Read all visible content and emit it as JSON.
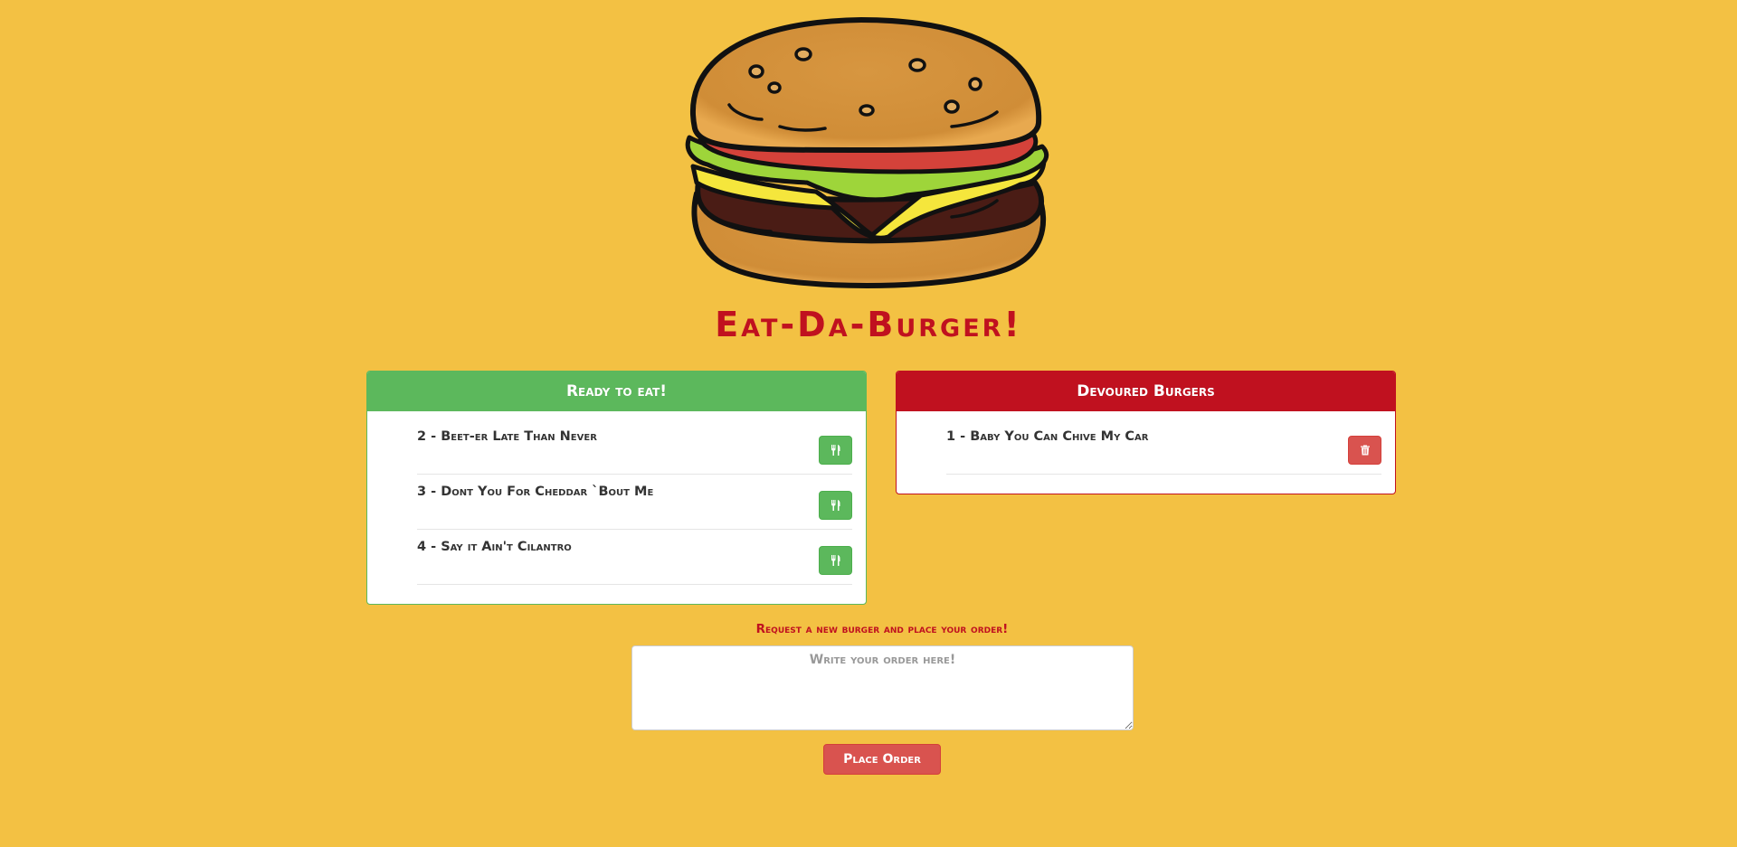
{
  "page": {
    "title": "Eat-Da-Burger!",
    "logo_icon": "hamburger-icon"
  },
  "ready_panel": {
    "heading": "Ready to eat!",
    "items": [
      {
        "label": "2 - Beet-er Late Than Never",
        "button_icon": "cutlery-icon"
      },
      {
        "label": "3 - Dont You For Cheddar `Bout Me",
        "button_icon": "cutlery-icon"
      },
      {
        "label": "4 - Say it Ain't Cilantro",
        "button_icon": "cutlery-icon"
      }
    ]
  },
  "devoured_panel": {
    "heading": "Devoured Burgers",
    "items": [
      {
        "label": "1 - Baby You Can Chive My Car",
        "button_icon": "trash-icon"
      }
    ]
  },
  "order_form": {
    "label": "Request a new burger and place your order!",
    "placeholder": "Write your order here!",
    "value": "",
    "submit_label": "Place Order"
  },
  "colors": {
    "background": "#f3c143",
    "brand_red": "#c0111f",
    "success_green": "#5cb85c",
    "danger_red": "#d9534f"
  }
}
